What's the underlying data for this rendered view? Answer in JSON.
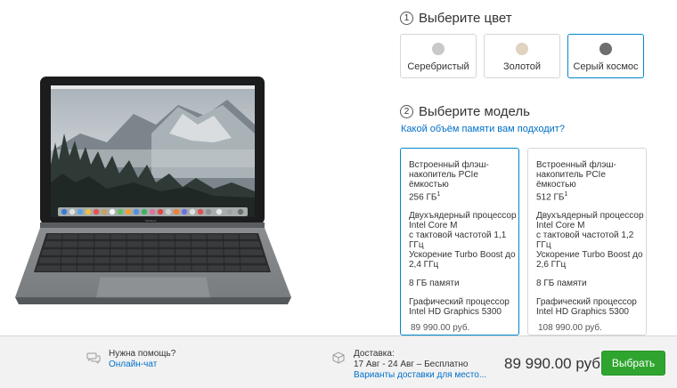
{
  "step1": {
    "number": "1",
    "title": "Выберите цвет"
  },
  "colors": [
    {
      "label": "Серебристый",
      "swatch": "#c9c9c9",
      "selected": false
    },
    {
      "label": "Золотой",
      "swatch": "#e0d3bf",
      "selected": false
    },
    {
      "label": "Серый космос",
      "swatch": "#6e6e6e",
      "selected": true
    }
  ],
  "step2": {
    "number": "2",
    "title": "Выберите модель"
  },
  "memory_link": "Какой объём памяти вам подходит?",
  "models": [
    {
      "storage": "Встроенный флэш-\nнакопитель PCIe ёмкостью\n256 ГБ",
      "footnote": "1",
      "cpu": "Двухъядерный процессор\nIntel Core M\nс тактовой частотой 1,1 ГГц\nУскорение Turbo Boost до\n2,4 ГГц",
      "memory": "8 ГБ памяти",
      "gpu": "Графический процессор\nIntel HD Graphics 5300",
      "price": "89 990.00 руб.",
      "selected": true
    },
    {
      "storage": "Встроенный флэш-\nнакопитель PCIe ёмкостью\n512 ГБ",
      "footnote": "1",
      "cpu": "Двухъядерный процессор\nIntel Core M\nс тактовой частотой 1,2 ГГц\nУскорение Turbo Boost до\n2,6 ГГц",
      "memory": "8 ГБ памяти",
      "gpu": "Графический процессор\nIntel HD Graphics 5300",
      "price": "108 990.00 руб.",
      "selected": false
    }
  ],
  "laptop": {
    "brand": "MacBook"
  },
  "footer": {
    "help_title": "Нужна помощь?",
    "help_link": "Онлайн-чат",
    "shipping_title": "Доставка:",
    "shipping_dates": "17 Авг - 24 Авг – Бесплатно",
    "shipping_link": "Варианты доставки для место...",
    "total_price": "89 990.00 руб.",
    "select_button": "Выбрать"
  },
  "colors_theme": {
    "accent_blue": "#0088cc",
    "link_blue": "#0070c9",
    "button_green": "#2fa52f"
  }
}
